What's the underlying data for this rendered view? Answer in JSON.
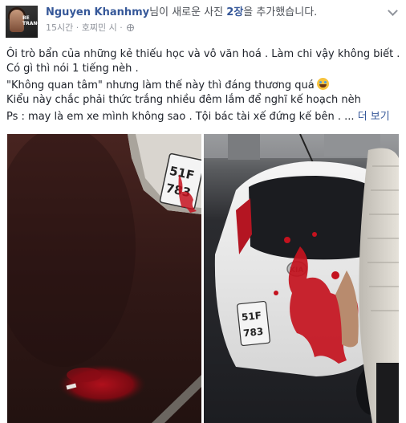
{
  "post": {
    "author": "Nguyen Khanhmy",
    "activity_suffix_pre": "님이 새로운 사진 ",
    "activity_bold": "2장",
    "activity_suffix_post": "을 추가했습니다.",
    "time": "15시간",
    "location_separator": " · ",
    "location": "호찌민 시",
    "location_dot": " · ",
    "avatar_text": "BE TRANG",
    "lines": [
      "Ôi trò bẩn của những kẻ thiếu học và vô văn hoá . Làm chi vậy không biết .",
      "Có gì thì nói 1 tiếng nèh .",
      "\"Không quan tâm\" nhưng làm thế này thì đáng thương quá",
      "Kiểu này chắc phải thức trắng nhiều đêm lắm để nghĩ kế hoạch nèh"
    ],
    "ps_line": "Ps : may là em xe mình không sao . Tội bác tài xế đứng kế bên . ...",
    "see_more": "더 보기",
    "plate_left": [
      "51F",
      "783"
    ],
    "plate_right": [
      "51F",
      "783"
    ]
  },
  "icons": {
    "globe": "globe-icon",
    "chevron": "chevron-down-icon",
    "emoji": "laughing-emoji-icon",
    "car_logo": "kia-logo-icon"
  },
  "colors": {
    "link": "#365899",
    "text": "#1d2129",
    "meta": "#90949c",
    "blood": "#c4121e"
  }
}
